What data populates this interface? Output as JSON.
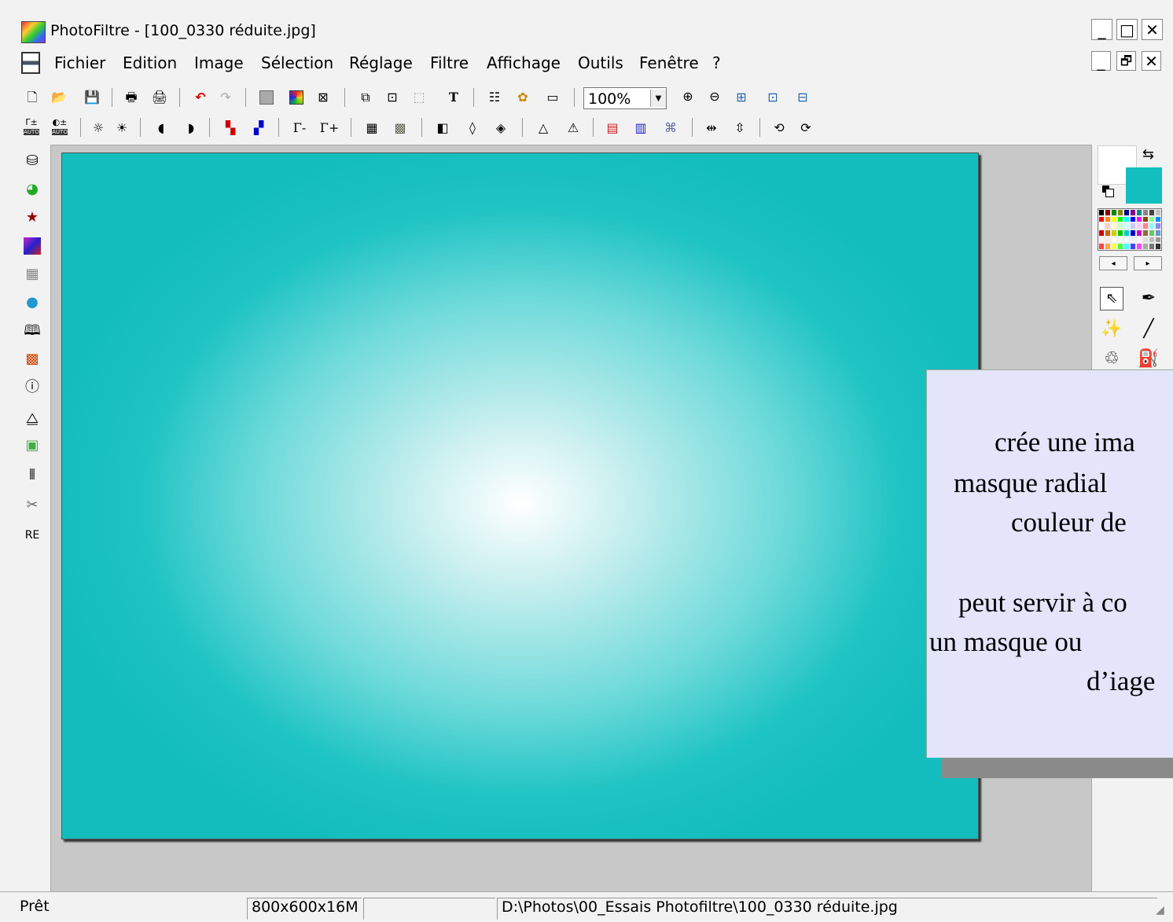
{
  "window": {
    "title": "PhotoFiltre - [100_0330 réduite.jpg]",
    "app_controls": [
      "_",
      "□",
      "✕"
    ],
    "doc_controls": [
      "_",
      "🗗",
      "✕"
    ]
  },
  "menubar": {
    "items": [
      "Fichier",
      "Edition",
      "Image",
      "Sélection",
      "Réglage",
      "Filtre",
      "Affichage",
      "Outils",
      "Fenêtre",
      "?"
    ]
  },
  "toolbar_main": {
    "icons": [
      "new-icon",
      "open-icon",
      "save-icon",
      "print-icon",
      "scan-icon",
      "undo-icon",
      "redo-icon",
      "grayscale-icon",
      "colors-icon",
      "transparency-icon",
      "copy-image-icon",
      "paste-image-icon",
      "selection-icon",
      "text-icon",
      "layers-icon",
      "palette-icon",
      "window-icon",
      "zoom-in-icon",
      "zoom-out-icon",
      "fit-icon",
      "actual-size-icon",
      "fullscreen-icon"
    ],
    "zoom_value": "100%"
  },
  "toolbar_adjust": {
    "labels": [
      "AUTO",
      "AUTO",
      "Γ-",
      "Γ+"
    ]
  },
  "left_toolbar": {
    "last_label": "RE"
  },
  "right_panel": {
    "fg_color": "#ffffff",
    "bg_color": "#13bebe"
  },
  "overlay": {
    "lines": [
      "crée une ima",
      "masque radial",
      "couleur de",
      "peut servir à co",
      "un masque ou",
      "d’iage"
    ]
  },
  "statusbar": {
    "status": "Prêt",
    "dimensions": "800x600x16M",
    "path": "D:\\Photos\\00_Essais Photofiltre\\100_0330 réduite.jpg"
  }
}
